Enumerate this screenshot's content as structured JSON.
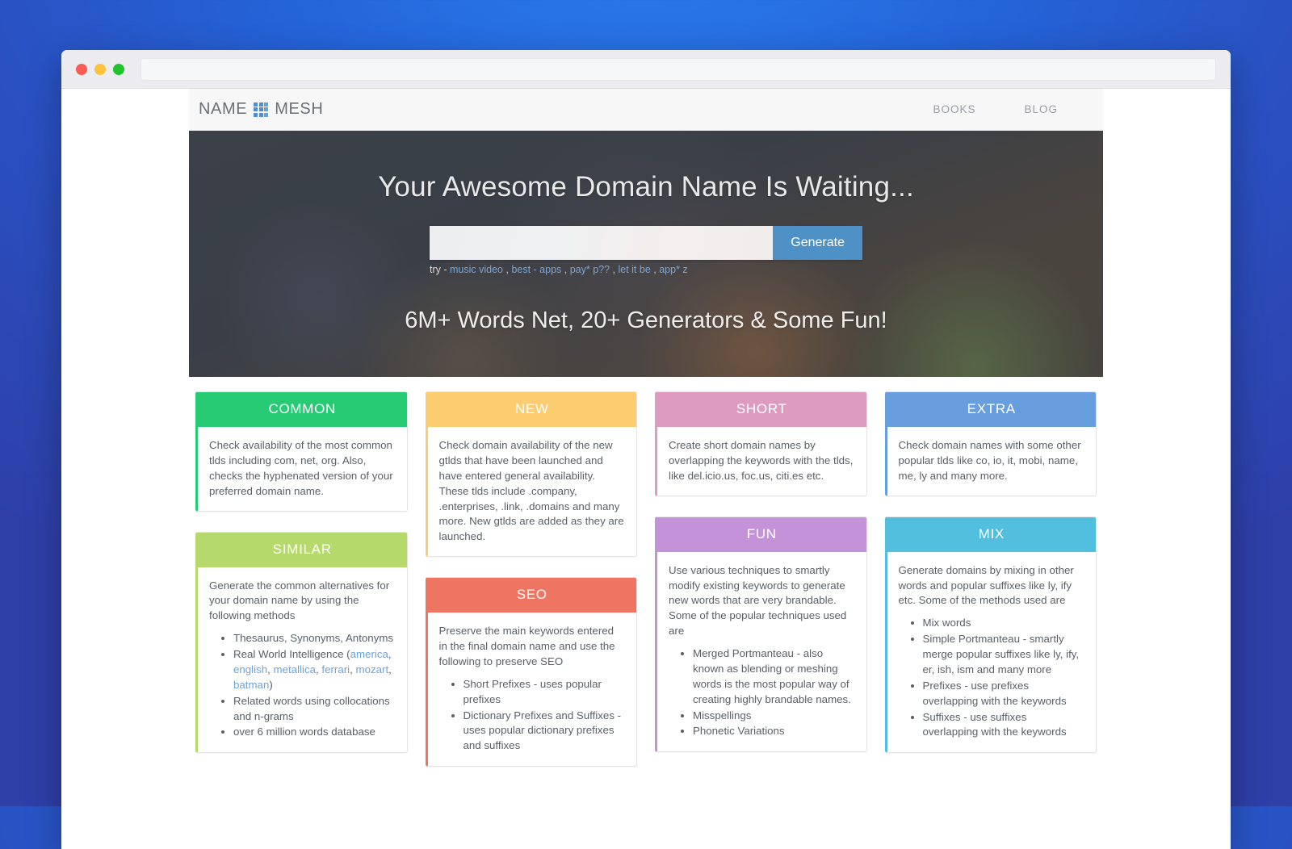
{
  "browser": {
    "traffic_lights": [
      "close-red",
      "minimize-yellow",
      "maximize-green"
    ],
    "url_value": ""
  },
  "nav": {
    "logo_first": "NAME",
    "logo_second": "MESH",
    "logo_icon": "grid-icon",
    "links": [
      {
        "label": "BOOKS"
      },
      {
        "label": "BLOG"
      }
    ]
  },
  "hero": {
    "title": "Your Awesome Domain Name Is Waiting...",
    "search_placeholder": "",
    "search_value": "",
    "generate_label": "Generate",
    "try_label": "try -",
    "try_links": [
      "music video",
      "best - apps",
      "pay* p??",
      "let it be",
      "app* z"
    ],
    "subtitle": "6M+ Words Net, 20+ Generators & Some Fun!"
  },
  "cards": [
    {
      "id": "common",
      "title": "COMMON",
      "color": "#27cb74",
      "body": "Check availability of the most common tlds including com, net, org. Also, checks the hyphenated version of your preferred domain name.",
      "items": []
    },
    {
      "id": "similar",
      "title": "SIMILAR",
      "color": "#b5d96a",
      "body": "Generate the common alternatives for your domain name by using the following methods",
      "items": [
        "Thesaurus, Synonyms, Antonyms",
        "Real World Intelligence (america, english, metallica, ferrari, mozart, batman)",
        "Related words using collocations and n-grams",
        "over 6 million words database"
      ],
      "links_in_items": [
        "america",
        "english",
        "metallica",
        "ferrari",
        "mozart",
        "batman"
      ]
    },
    {
      "id": "new",
      "title": "NEW",
      "color": "#fbcd70",
      "body": "Check domain availability of the new gtlds that have been launched and have entered general availability. These tlds include .company, .enterprises, .link, .domains and many more. New gtlds are added as they are launched.",
      "items": []
    },
    {
      "id": "seo",
      "title": "SEO",
      "color": "#ef7563",
      "body": "Preserve the main keywords entered in the final domain name and use the following to preserve SEO",
      "items": [
        "Short Prefixes - uses popular prefixes",
        "Dictionary Prefixes and Suffixes - uses popular dictionary prefixes and suffixes"
      ]
    },
    {
      "id": "short",
      "title": "SHORT",
      "color": "#dd9cbf",
      "body": "Create short domain names by overlapping the keywords with the tlds, like del.icio.us, foc.us, citi.es etc.",
      "items": []
    },
    {
      "id": "fun",
      "title": "FUN",
      "color": "#c492d8",
      "body": "Use various techniques to smartly modify existing keywords to generate new words that are very brandable. Some of the popular techniques used are",
      "items": [
        "Merged Portmanteau - also known as blending or meshing words is the most popular way of creating highly brandable names.",
        "Misspellings",
        "Phonetic Variations"
      ]
    },
    {
      "id": "extra",
      "title": "EXTRA",
      "color": "#679ede",
      "body": "Check domain names with some other popular tlds like co, io, it, mobi, name, me, ly and many more.",
      "items": []
    },
    {
      "id": "mix",
      "title": "MIX",
      "color": "#52bfdf",
      "body": "Generate domains by mixing in other words and popular suffixes like ly, ify etc. Some of the methods used are",
      "items": [
        "Mix words",
        "Simple Portmanteau - smartly merge popular suffixes like ly, ify, er, ish, ism and many more",
        "Prefixes - use prefixes overlapping with the keywords",
        "Suffixes - use suffixes overlapping with the keywords"
      ]
    }
  ]
}
